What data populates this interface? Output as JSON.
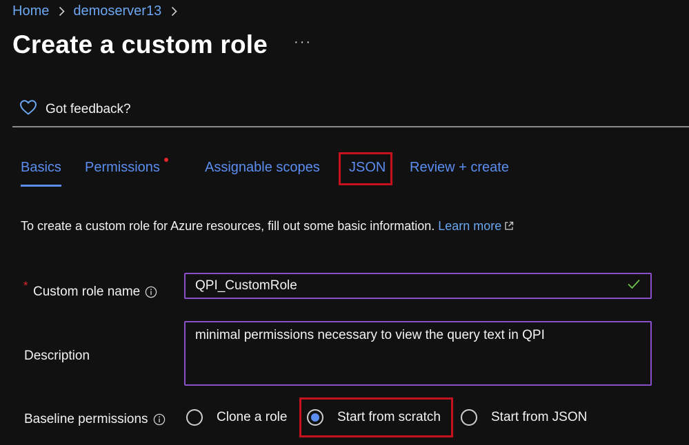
{
  "breadcrumb": {
    "home": "Home",
    "server": "demoserver13"
  },
  "page": {
    "title": "Create a custom role",
    "more_label": "···"
  },
  "feedback": {
    "label": "Got feedback?",
    "icon": "heart-icon"
  },
  "tabs": [
    {
      "label": "Basics",
      "active": true
    },
    {
      "label": "Permissions",
      "has_error_dot": true
    },
    {
      "label": "Assignable scopes"
    },
    {
      "label": "JSON",
      "highlighted": true
    },
    {
      "label": "Review + create"
    }
  ],
  "intro": {
    "text": "To create a custom role for Azure resources, fill out some basic information.",
    "learn_more": "Learn more"
  },
  "form": {
    "name_label": "Custom role name",
    "name_required_mark": "*",
    "name_value": "QPI_CustomRole",
    "description_label": "Description",
    "description_value": "minimal permissions necessary to view the query text in QPI",
    "baseline_label": "Baseline permissions",
    "baseline_options": [
      {
        "label": "Clone a role",
        "selected": false
      },
      {
        "label": "Start from scratch",
        "selected": true,
        "highlighted": true
      },
      {
        "label": "Start from JSON",
        "selected": false
      }
    ]
  },
  "colors": {
    "background": "#111111",
    "link": "#6ca6f0",
    "tab": "#5b8ef0",
    "highlight_border": "#c5121e",
    "input_border": "#8a4fc9",
    "valid_check": "#6cc24a",
    "required": "#e0252b"
  }
}
